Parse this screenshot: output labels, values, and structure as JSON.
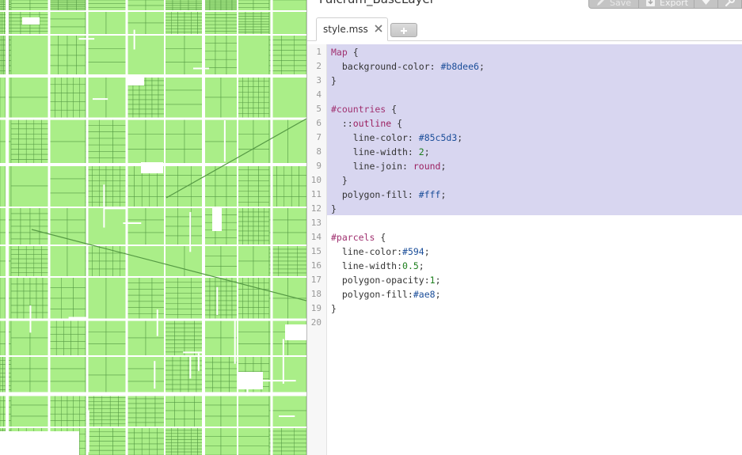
{
  "app": {
    "project_title": "Fulcrum_BaseLayer"
  },
  "toolbar": {
    "save_label": "Save",
    "export_label": "Export"
  },
  "tabs": [
    {
      "label": "style.mss",
      "active": true
    }
  ],
  "editor": {
    "lines": [
      {
        "n": "1",
        "code": [
          {
            "t": "Map",
            "c": "t-sel"
          },
          {
            "t": " {"
          }
        ]
      },
      {
        "n": "2",
        "code": [
          {
            "t": "  background-color: "
          },
          {
            "t": "#b8dee6",
            "c": "t-col"
          },
          {
            "t": ";"
          }
        ]
      },
      {
        "n": "3",
        "code": [
          {
            "t": "}"
          }
        ]
      },
      {
        "n": "4",
        "code": []
      },
      {
        "n": "5",
        "code": [
          {
            "t": "#countries",
            "c": "t-sel"
          },
          {
            "t": " {"
          }
        ]
      },
      {
        "n": "6",
        "code": [
          {
            "t": "  ::"
          },
          {
            "t": "outline",
            "c": "t-kw"
          },
          {
            "t": " {"
          }
        ]
      },
      {
        "n": "7",
        "code": [
          {
            "t": "    line-color: "
          },
          {
            "t": "#85c5d3",
            "c": "t-col"
          },
          {
            "t": ";"
          }
        ]
      },
      {
        "n": "8",
        "code": [
          {
            "t": "    line-width: "
          },
          {
            "t": "2",
            "c": "t-num"
          },
          {
            "t": ";"
          }
        ]
      },
      {
        "n": "9",
        "code": [
          {
            "t": "    line-join: "
          },
          {
            "t": "round",
            "c": "t-kw"
          },
          {
            "t": ";"
          }
        ]
      },
      {
        "n": "10",
        "code": [
          {
            "t": "  }"
          }
        ]
      },
      {
        "n": "11",
        "code": [
          {
            "t": "  polygon-fill: "
          },
          {
            "t": "#fff",
            "c": "t-col"
          },
          {
            "t": ";"
          }
        ]
      },
      {
        "n": "12",
        "code": [
          {
            "t": "}"
          }
        ]
      },
      {
        "n": "13",
        "code": []
      },
      {
        "n": "14",
        "code": [
          {
            "t": "#parcels",
            "c": "t-sel"
          },
          {
            "t": " {"
          }
        ]
      },
      {
        "n": "15",
        "code": [
          {
            "t": "  line-color:"
          },
          {
            "t": "#594",
            "c": "t-col"
          },
          {
            "t": ";"
          }
        ]
      },
      {
        "n": "16",
        "code": [
          {
            "t": "  line-width:"
          },
          {
            "t": "0.5",
            "c": "t-num"
          },
          {
            "t": ";"
          }
        ]
      },
      {
        "n": "17",
        "code": [
          {
            "t": "  polygon-opacity:"
          },
          {
            "t": "1",
            "c": "t-num"
          },
          {
            "t": ";"
          }
        ]
      },
      {
        "n": "18",
        "code": [
          {
            "t": "  polygon-fill:"
          },
          {
            "t": "#ae8",
            "c": "t-col"
          },
          {
            "t": ";"
          }
        ]
      },
      {
        "n": "19",
        "code": [
          {
            "t": "}"
          }
        ]
      },
      {
        "n": "20",
        "code": []
      }
    ]
  },
  "map": {
    "parcel_fill": "#aaee88",
    "parcel_line": "#559944",
    "road_color": "#ffffff"
  },
  "colors": {
    "selection": "#d8d6f0",
    "toolbar_button": "#c4c4c4"
  },
  "icons": {
    "save": "pencil-icon",
    "export": "download-icon",
    "export_menu": "caret-down-icon",
    "settings": "wrench-icon",
    "tab_close": "close-icon",
    "add_tab": "plus-icon"
  }
}
